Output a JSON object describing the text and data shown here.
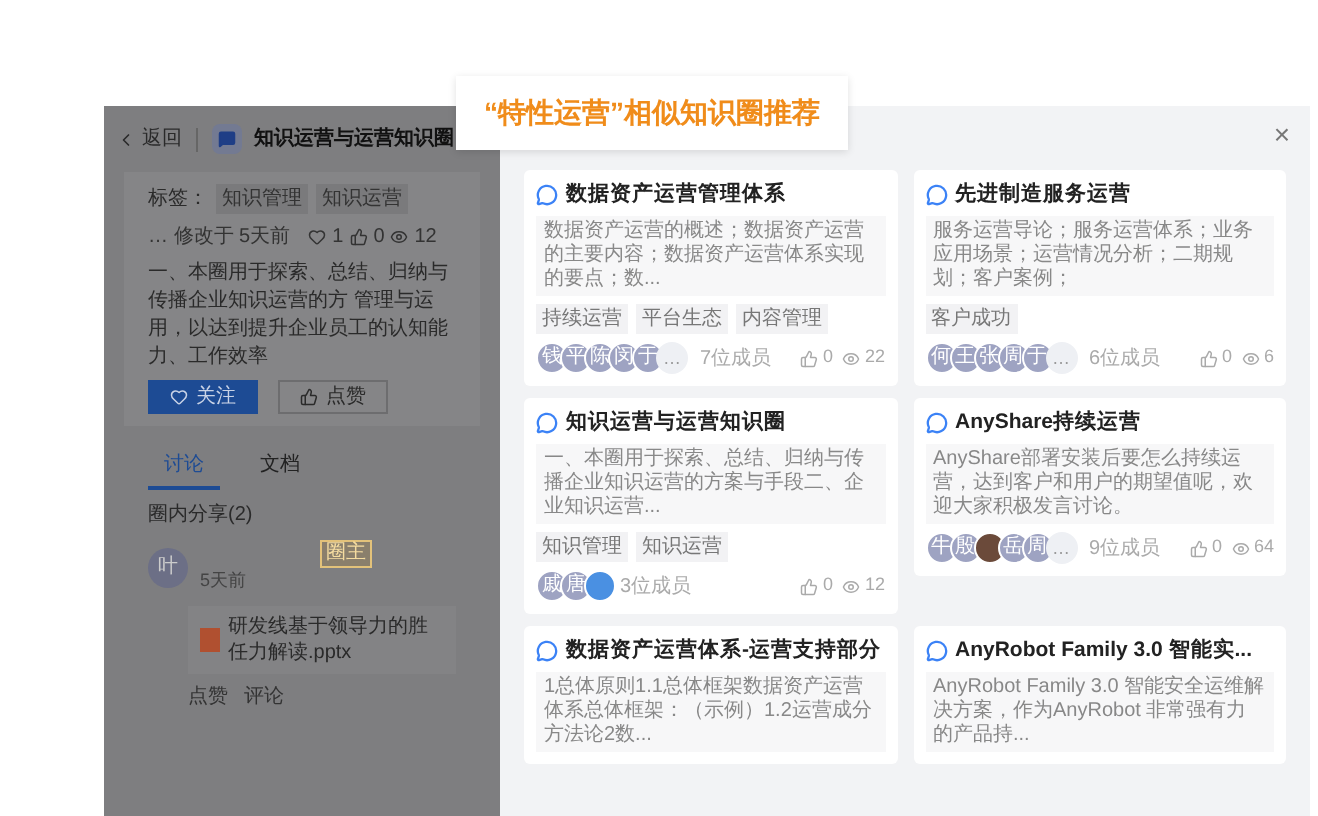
{
  "background_page": {
    "back": "返回",
    "title": "知识运营与运营知识圈",
    "tags_label": "标签：",
    "tags": [
      "知识管理",
      "知识运营"
    ],
    "meta": "… 修改于 5天前",
    "likes": "1",
    "thumbs": "0",
    "views": "12",
    "intro": "一、本圈用于探索、总结、归纳与传播企业知识运营的方 管理与运用，以达到提升企业员工的认知能力、工作效率",
    "buttons": [
      {
        "label": "关注",
        "kind": "primary"
      },
      {
        "label": "点赞",
        "kind": "secondary"
      }
    ],
    "tabs": [
      {
        "label": "讨论",
        "selected": true
      },
      {
        "label": "文档",
        "selected": false
      }
    ],
    "share_count": "圈内分享(2)",
    "post": {
      "avatar": "叶",
      "badge": "圈主",
      "time": "5天前",
      "file": "研发线基于领导力的胜任力解读.pptx",
      "actions": [
        "点赞",
        "评论"
      ]
    }
  },
  "dialog": {
    "title": "“特性运营”相似知识圈推荐",
    "close": "×",
    "cards": [
      {
        "title": "数据资产运营管理体系",
        "description": "数据资产运营的概述；数据资产运营的主要内容；数据资产运营体系实现的要点；数...",
        "tags": [
          "持续运营",
          "平台生态",
          "内容管理"
        ],
        "avatars": [
          {
            "kind": "letter",
            "text": "钱"
          },
          {
            "kind": "letter",
            "text": "平"
          },
          {
            "kind": "letter",
            "text": "陈"
          },
          {
            "kind": "letter",
            "text": "闵"
          },
          {
            "kind": "letter",
            "text": "于"
          }
        ],
        "more": "…",
        "members": "7位成员",
        "likes": "0",
        "views": "22"
      },
      {
        "title": "先进制造服务运营",
        "description": "服务运营导论；服务运营体系；业务应用场景；运营情况分析；二期规划；客户案例；",
        "tags": [
          "客户成功"
        ],
        "avatars": [
          {
            "kind": "letter",
            "text": "何"
          },
          {
            "kind": "letter",
            "text": "王"
          },
          {
            "kind": "letter",
            "text": "张"
          },
          {
            "kind": "letter",
            "text": "周"
          },
          {
            "kind": "letter",
            "text": "于"
          }
        ],
        "more": "…",
        "members": "6位成员",
        "likes": "0",
        "views": "6"
      },
      {
        "title": "知识运营与运营知识圈",
        "description": "一、本圈用于探索、总结、归纳与传播企业知识运营的方案与手段二、企业知识运营...",
        "tags": [
          "知识管理",
          "知识运营"
        ],
        "avatars": [
          {
            "kind": "letter",
            "text": "戚"
          },
          {
            "kind": "letter",
            "text": "唐"
          },
          {
            "kind": "logo"
          }
        ],
        "members": "3位成员",
        "likes": "0",
        "views": "12"
      },
      {
        "title": "AnyShare持续运营",
        "description": "AnyShare部署安装后要怎么持续运营，达到客户和用户的期望值呢，欢迎大家积极发言讨论。",
        "avatars": [
          {
            "kind": "letter",
            "text": "牛"
          },
          {
            "kind": "letter",
            "text": "殷"
          },
          {
            "kind": "photo"
          },
          {
            "kind": "letter",
            "text": "岳"
          },
          {
            "kind": "letter",
            "text": "周"
          }
        ],
        "more": "…",
        "members": "9位成员",
        "likes": "0",
        "views": "64"
      },
      {
        "title": "数据资产运营体系-运营支持部分",
        "description": "1总体原则1.1总体框架数据资产运营体系总体框架：（示例）1.2运营成分方法论2数..."
      },
      {
        "title": "AnyRobot Family 3.0 智能实...",
        "description": "AnyRobot Family 3.0 智能安全运维解决方案，作为AnyRobot 非常强有力的产品持..."
      }
    ]
  }
}
